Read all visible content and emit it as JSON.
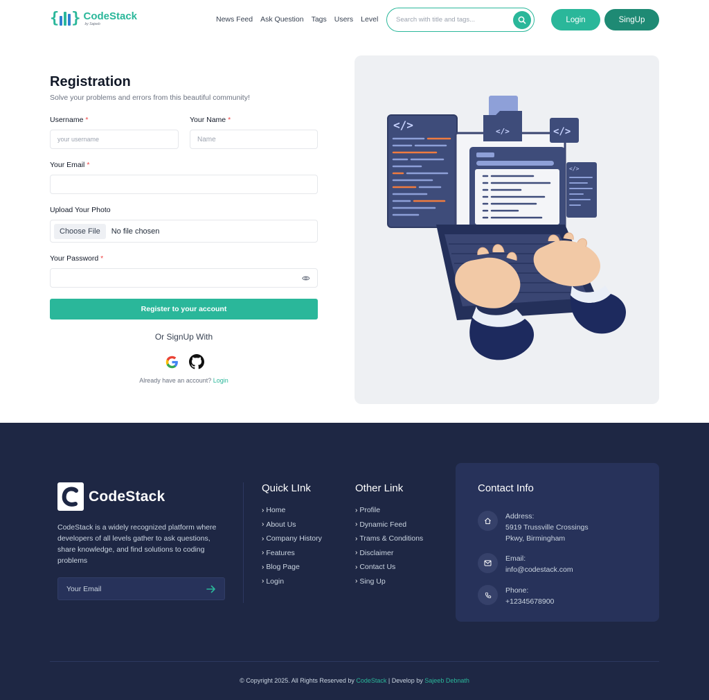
{
  "brand": {
    "name": "CodeStack",
    "byline": "by Sajeeb",
    "primary_color": "#2ab79a",
    "footer_bg": "#1e2744"
  },
  "header": {
    "nav": [
      "News Feed",
      "Ask Question",
      "Tags",
      "Users",
      "Level"
    ],
    "search_placeholder": "Search with title and tags...",
    "login_label": "Login",
    "signup_label": "SingUp"
  },
  "form": {
    "title": "Registration",
    "subtitle": "Solve your problems and errors from this beautiful community!",
    "username_label": "Username",
    "username_placeholder": "your username",
    "name_label": "Your Name",
    "name_placeholder": "Name",
    "required_mark": "*",
    "email_label": "Your Email",
    "email_value": "",
    "photo_label": "Upload Your Photo",
    "file_button": "Choose File",
    "file_status": "No file chosen",
    "password_label": "Your Password",
    "password_value": "",
    "submit_label": "Register to your account",
    "or_text": "Or SignUp With",
    "already_text": "Already have an account?",
    "login_link": "Login"
  },
  "footer": {
    "logo_name": "CodeStack",
    "description": "CodeStack is a widely recognized platform where developers of all levels gather to ask questions, share knowledge, and find solutions to coding problems",
    "email_placeholder": "Your Email",
    "quick_title": "Quick LInk",
    "quick_links": [
      "Home",
      "About Us",
      "Company History",
      "Features",
      "Blog Page",
      "Login"
    ],
    "other_title": "Other Link",
    "other_links": [
      "Profile",
      "Dynamic Feed",
      "Trams & Conditions",
      "Disclaimer",
      "Contact Us",
      "Sing Up"
    ],
    "contact_title": "Contact Info",
    "address_label": "Address:",
    "address_value": "5919 Trussville Crossings Pkwy, Birmingham",
    "email_label": "Email:",
    "email_value": "info@codestack.com",
    "phone_label": "Phone:",
    "phone_value": "+12345678900",
    "copyright_prefix": "© Copyright 2025. All Rights Reserved by",
    "copyright_brand": "CodeStack",
    "developer_prefix": "| Develop by",
    "developer_name": "Sajeeb Debnath"
  }
}
